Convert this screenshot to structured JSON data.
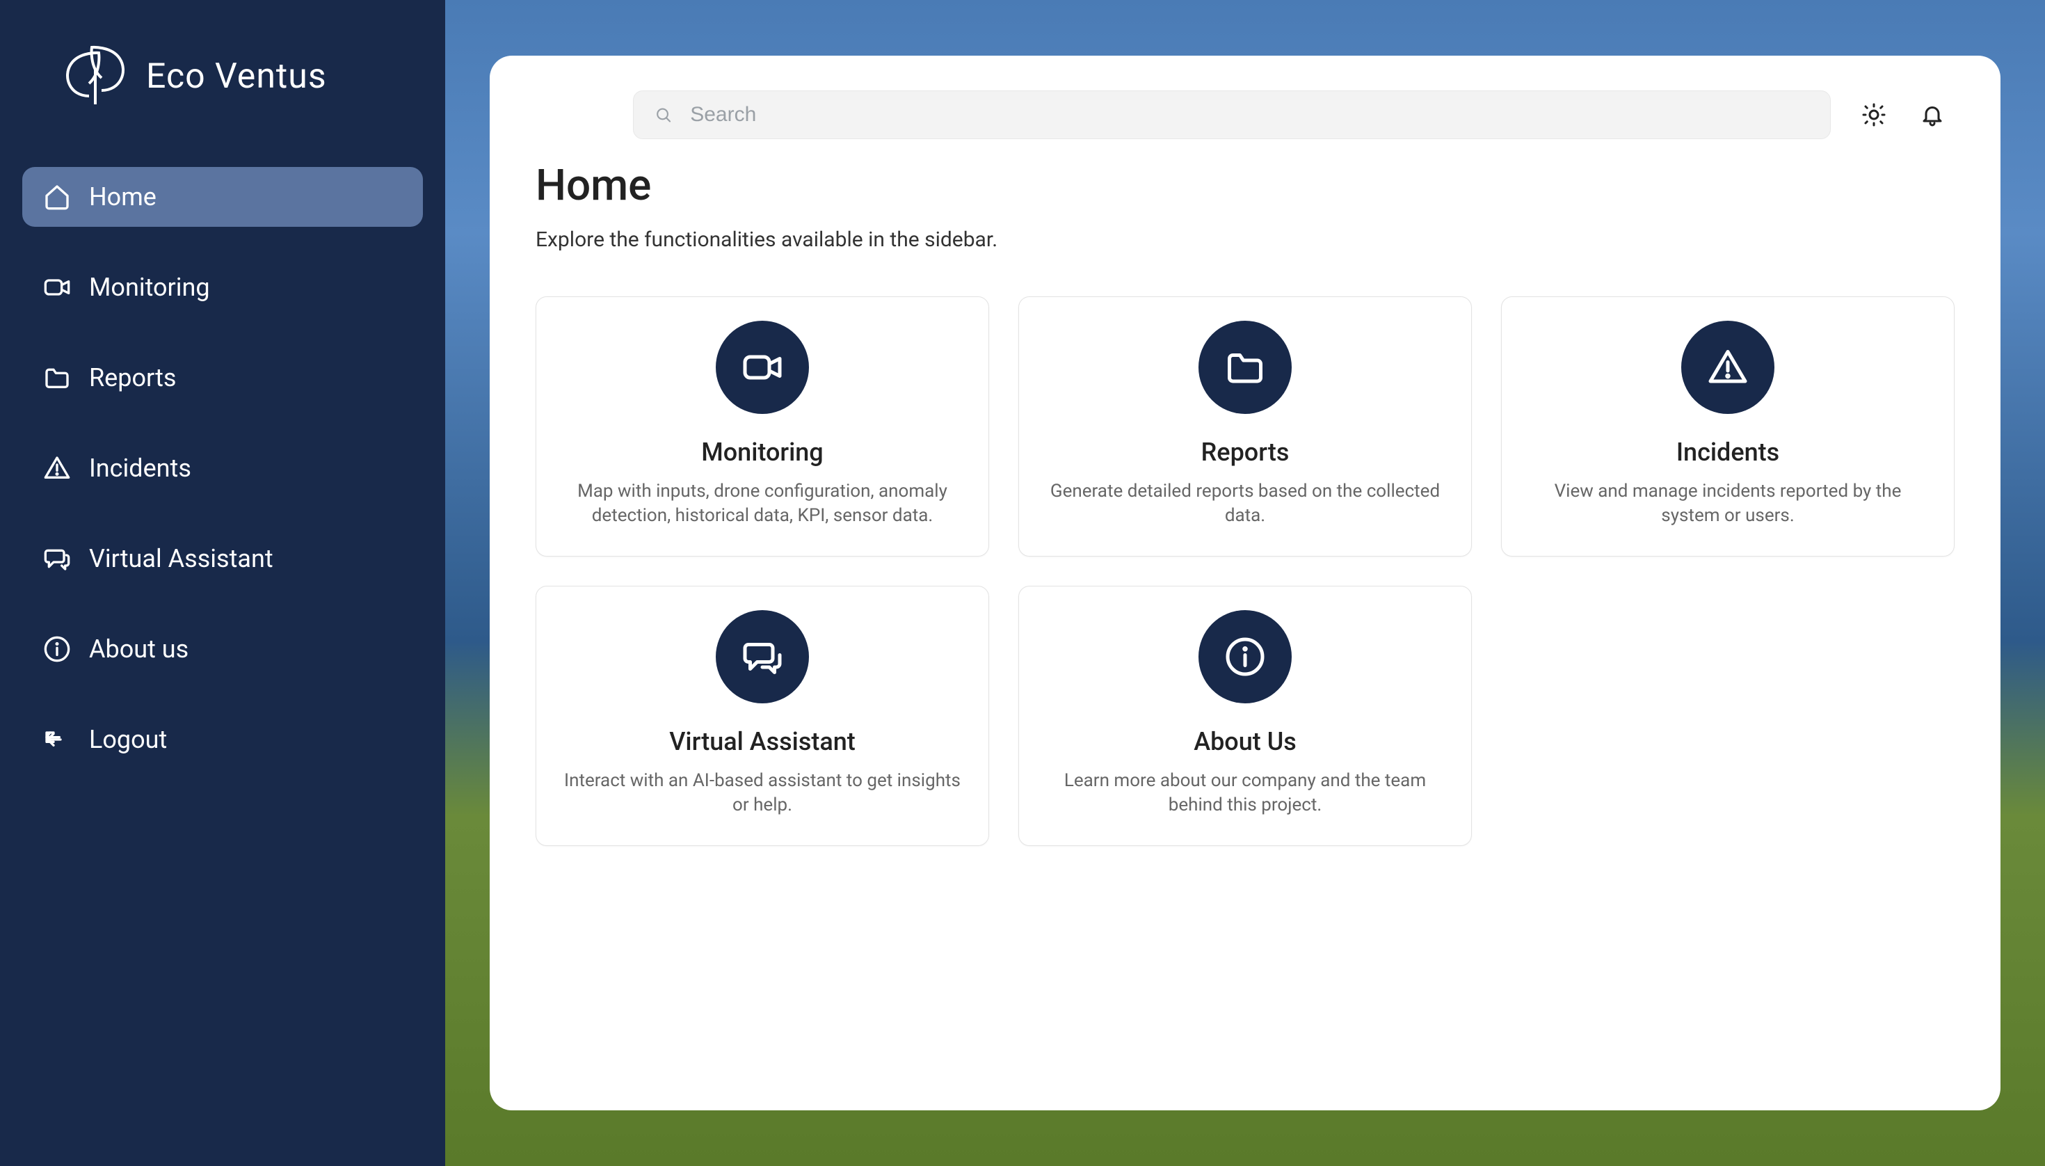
{
  "brand": {
    "name": "Eco Ventus"
  },
  "sidebar": {
    "items": [
      {
        "label": "Home"
      },
      {
        "label": "Monitoring"
      },
      {
        "label": "Reports"
      },
      {
        "label": "Incidents"
      },
      {
        "label": "Virtual Assistant"
      },
      {
        "label": "About us"
      },
      {
        "label": "Logout"
      }
    ]
  },
  "search": {
    "placeholder": "Search"
  },
  "page": {
    "title": "Home",
    "subtitle": "Explore the functionalities available in the sidebar."
  },
  "cards": [
    {
      "title": "Monitoring",
      "desc": "Map with inputs, drone configuration, anomaly detection, historical data, KPI, sensor data."
    },
    {
      "title": "Reports",
      "desc": "Generate detailed reports based on the collected data."
    },
    {
      "title": "Incidents",
      "desc": "View and manage incidents reported by the system or users."
    },
    {
      "title": "Virtual Assistant",
      "desc": "Interact with an AI-based assistant to get insights or help."
    },
    {
      "title": "About Us",
      "desc": "Learn more about our company and the team behind this project."
    }
  ],
  "colors": {
    "sidebar_bg": "#18294a",
    "sidebar_active": "#5b74a0",
    "card_circle": "#18294a"
  }
}
